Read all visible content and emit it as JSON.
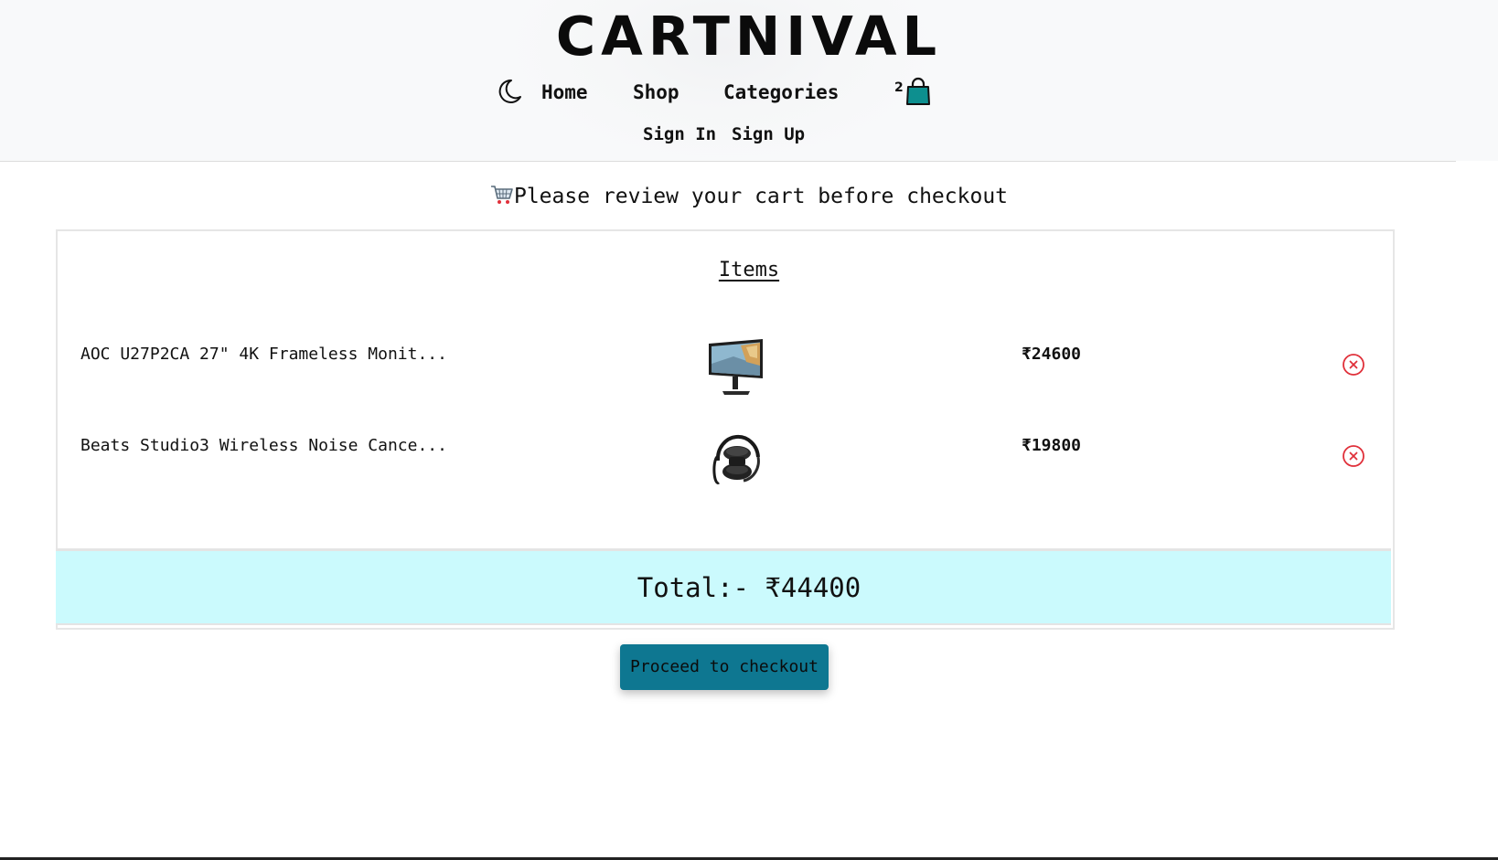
{
  "header": {
    "brand": "CARTNIVAL",
    "nav": {
      "home": "Home",
      "shop": "Shop",
      "categories": "Categories"
    },
    "cart_count": "2",
    "auth": {
      "sign_in": "Sign In",
      "sign_up": "Sign Up"
    },
    "icons": {
      "theme_toggle": "moon-icon",
      "cart": "shopping-bag-icon"
    }
  },
  "main": {
    "review_title": "Please review your cart before checkout",
    "items_heading": "Items",
    "items": [
      {
        "name": "AOC U27P2CA 27\" 4K Frameless Monit...",
        "image": "monitor-icon",
        "price": "₹24600"
      },
      {
        "name": "Beats Studio3 Wireless Noise Cance...",
        "image": "headphones-icon",
        "price": "₹19800"
      }
    ],
    "total_label": "Total:- ₹44400",
    "checkout_label": "Proceed to checkout"
  },
  "colors": {
    "accent_button": "#0e7791",
    "total_bar": "#cbfafd",
    "remove_icon": "#e0303a",
    "bag_icon": "#0d8f8f"
  }
}
